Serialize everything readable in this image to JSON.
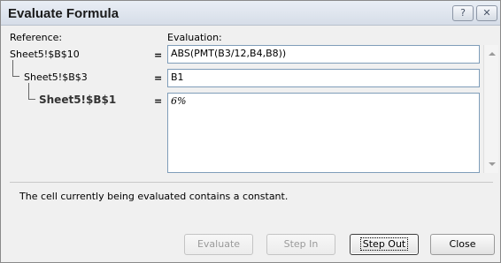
{
  "title": "Evaluate Formula",
  "titlebar": {
    "help_glyph": "?",
    "close_glyph": "✕"
  },
  "reference_label": "Reference:",
  "evaluation_label": "Evaluation:",
  "references": [
    {
      "ref": "Sheet5!$B$10",
      "eq": "=",
      "value": "ABS(PMT(B3/12,B4,B8))"
    },
    {
      "ref": "Sheet5!$B$3",
      "eq": "=",
      "value": "B1"
    },
    {
      "ref": "Sheet5!$B$1",
      "eq": "=",
      "value": "6%"
    }
  ],
  "status_text": "The cell currently being evaluated contains a constant.",
  "buttons": {
    "evaluate": "Evaluate",
    "step_in": "Step In",
    "step_out": "Step Out",
    "close": "Close"
  },
  "colors": {
    "field_border": "#7f9db9",
    "dialog_bg": "#f0f0f0",
    "disabled_text": "#9a9a9a"
  },
  "icons": {
    "scroll_up": "chevron-up-icon",
    "scroll_down": "chevron-down-icon"
  }
}
